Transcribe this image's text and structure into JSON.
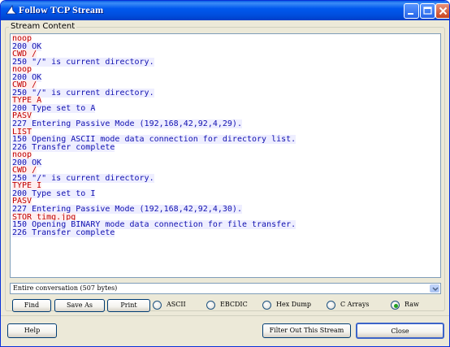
{
  "window": {
    "title": "Follow TCP Stream",
    "minimize_label": "_",
    "maximize_label": "□",
    "close_label": "✕"
  },
  "stream": {
    "group_label": "Stream Content",
    "lines": [
      {
        "dir": "client",
        "text": "noop"
      },
      {
        "dir": "server",
        "text": "200 OK"
      },
      {
        "dir": "client",
        "text": "CWD /"
      },
      {
        "dir": "server",
        "text": "250 \"/\" is current directory."
      },
      {
        "dir": "client",
        "text": "noop"
      },
      {
        "dir": "server",
        "text": "200 OK"
      },
      {
        "dir": "client",
        "text": "CWD /"
      },
      {
        "dir": "server",
        "text": "250 \"/\" is current directory."
      },
      {
        "dir": "client",
        "text": "TYPE A"
      },
      {
        "dir": "server",
        "text": "200 Type set to A"
      },
      {
        "dir": "client",
        "text": "PASV"
      },
      {
        "dir": "server",
        "text": "227 Entering Passive Mode (192,168,42,92,4,29)."
      },
      {
        "dir": "client",
        "text": "LIST"
      },
      {
        "dir": "server",
        "text": "150 Opening ASCII mode data connection for directory list."
      },
      {
        "dir": "server",
        "text": "226 Transfer complete"
      },
      {
        "dir": "client",
        "text": "noop"
      },
      {
        "dir": "server",
        "text": "200 OK"
      },
      {
        "dir": "client",
        "text": "CWD /"
      },
      {
        "dir": "server",
        "text": "250 \"/\" is current directory."
      },
      {
        "dir": "client",
        "text": "TYPE I"
      },
      {
        "dir": "server",
        "text": "200 Type set to I"
      },
      {
        "dir": "client",
        "text": "PASV"
      },
      {
        "dir": "server",
        "text": "227 Entering Passive Mode (192,168,42,92,4,30)."
      },
      {
        "dir": "client",
        "text": "STOR timg.jpg"
      },
      {
        "dir": "server",
        "text": "150 Opening BINARY mode data connection for file transfer."
      },
      {
        "dir": "server",
        "text": "226 Transfer complete"
      }
    ],
    "client_color": "#c00000",
    "server_color": "#1010b0"
  },
  "conversation_select": {
    "value": "Entire conversation (507 bytes)"
  },
  "actions": {
    "find": "Find",
    "save_as": "Save As",
    "print": "Print"
  },
  "format_options": [
    {
      "label": "ASCII",
      "selected": false
    },
    {
      "label": "EBCDIC",
      "selected": false
    },
    {
      "label": "Hex Dump",
      "selected": false
    },
    {
      "label": "C Arrays",
      "selected": false
    },
    {
      "label": "Raw",
      "selected": true
    }
  ],
  "footer": {
    "help": "Help",
    "filter_out": "Filter Out This Stream",
    "close": "Close"
  }
}
